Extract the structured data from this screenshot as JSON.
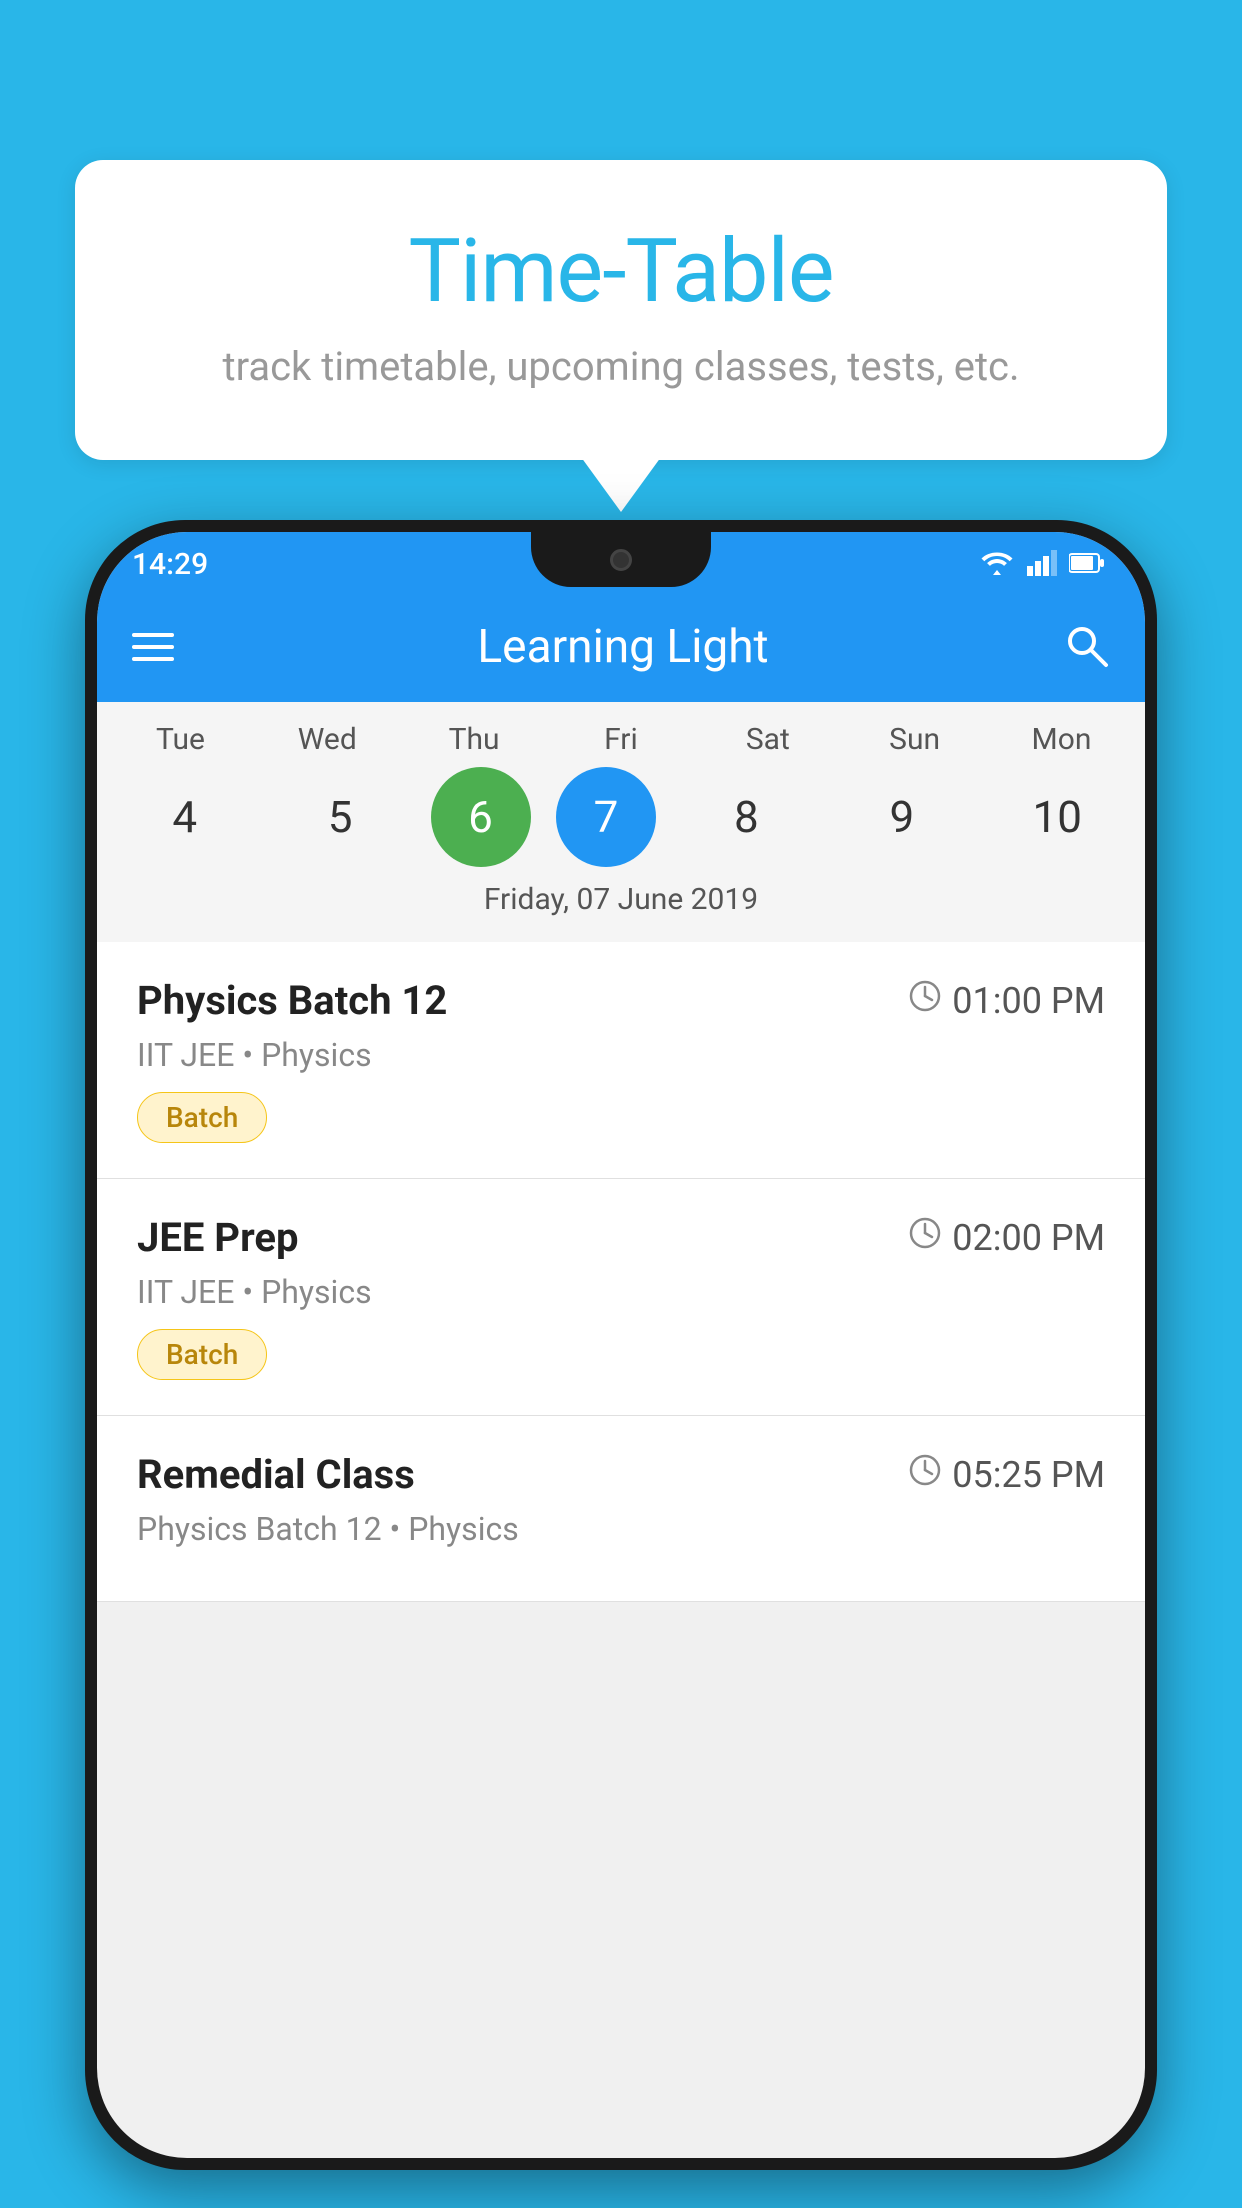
{
  "background_color": "#29B6E8",
  "bubble": {
    "title": "Time-Table",
    "subtitle": "track timetable, upcoming classes, tests, etc."
  },
  "phone": {
    "status_bar": {
      "time": "14:29"
    },
    "app_bar": {
      "title": "Learning Light"
    },
    "calendar": {
      "days": [
        {
          "label": "Tue",
          "number": "4",
          "state": "normal"
        },
        {
          "label": "Wed",
          "number": "5",
          "state": "normal"
        },
        {
          "label": "Thu",
          "number": "6",
          "state": "today"
        },
        {
          "label": "Fri",
          "number": "7",
          "state": "selected"
        },
        {
          "label": "Sat",
          "number": "8",
          "state": "normal"
        },
        {
          "label": "Sun",
          "number": "9",
          "state": "normal"
        },
        {
          "label": "Mon",
          "number": "10",
          "state": "normal"
        }
      ],
      "selected_date": "Friday, 07 June 2019"
    },
    "schedule": [
      {
        "title": "Physics Batch 12",
        "time": "01:00 PM",
        "subtitle": "IIT JEE • Physics",
        "badge": "Batch"
      },
      {
        "title": "JEE Prep",
        "time": "02:00 PM",
        "subtitle": "IIT JEE • Physics",
        "badge": "Batch"
      },
      {
        "title": "Remedial Class",
        "time": "05:25 PM",
        "subtitle": "Physics Batch 12 • Physics",
        "badge": null
      }
    ]
  }
}
